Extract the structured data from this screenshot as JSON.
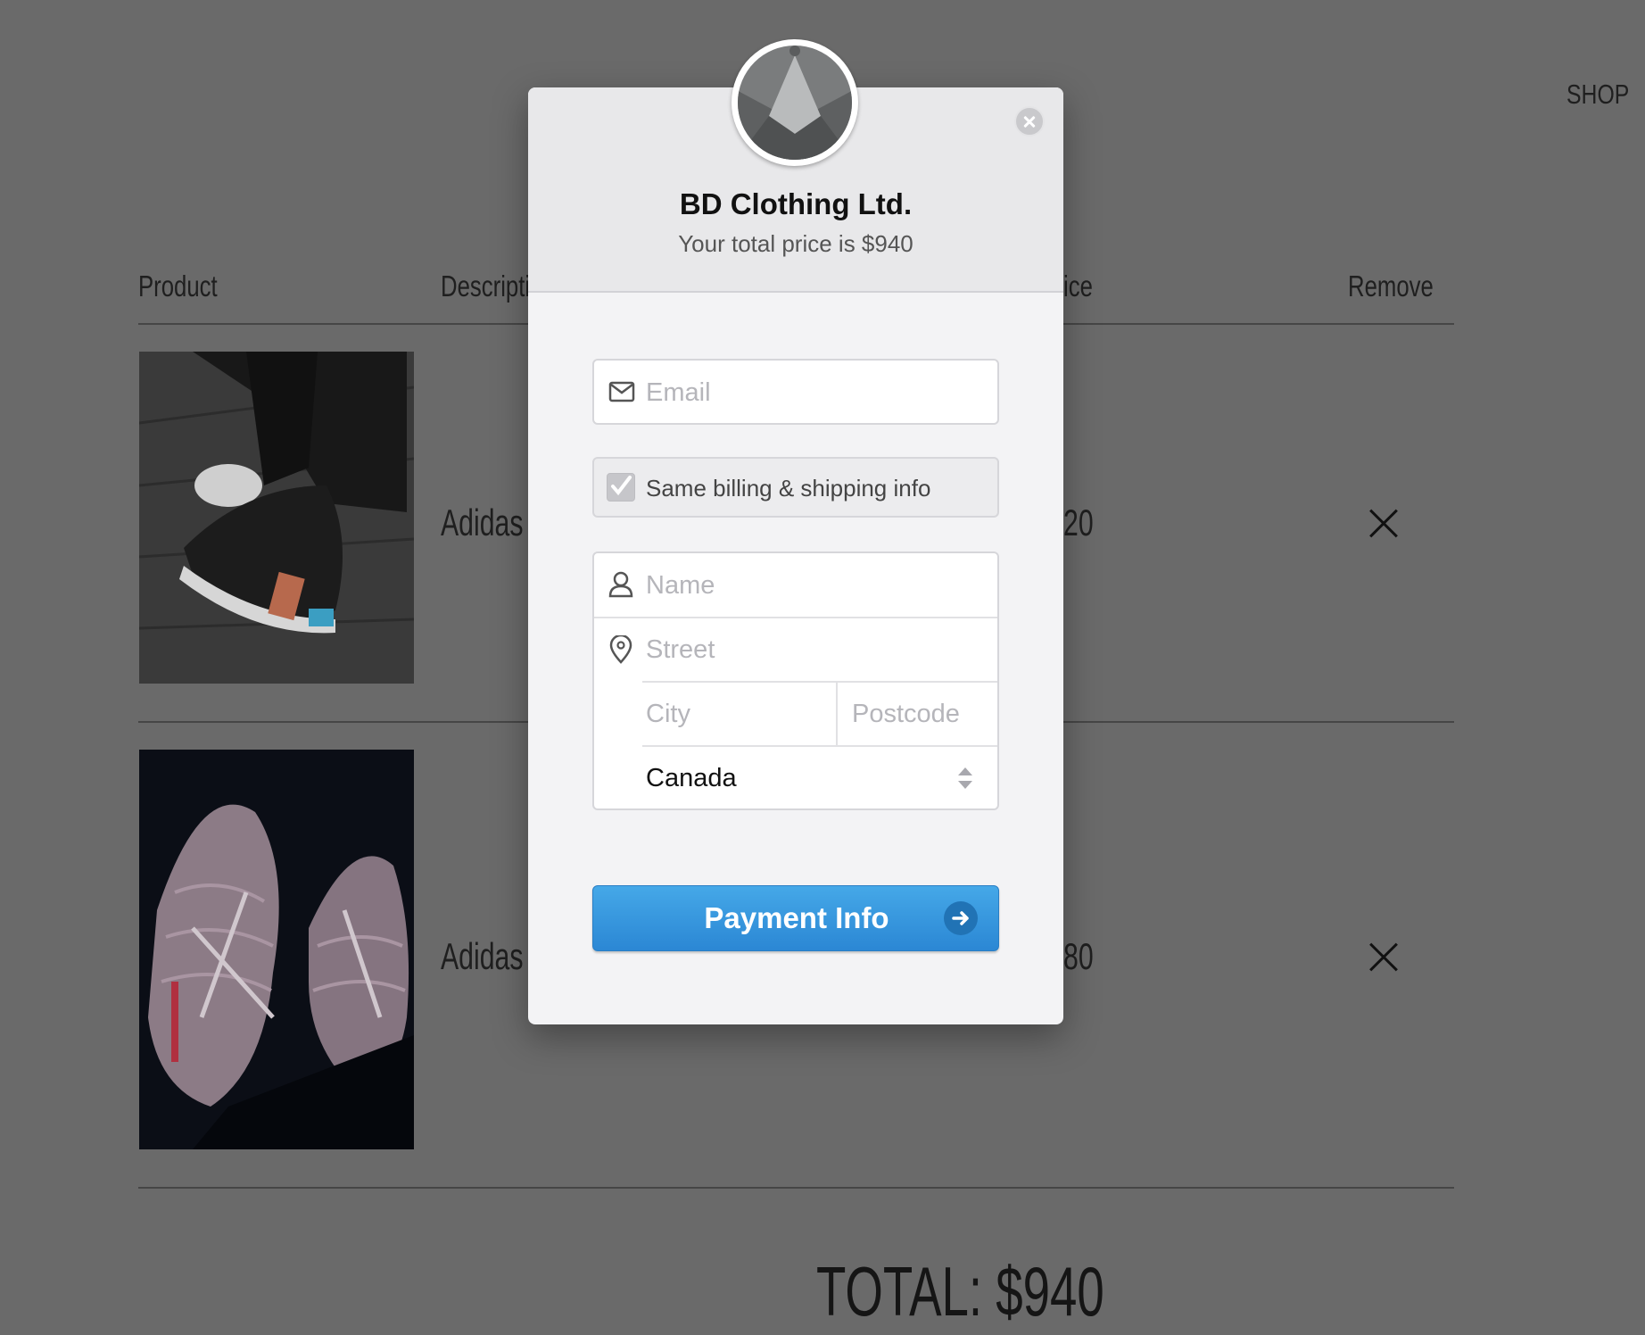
{
  "nav": {
    "shop": "SHOP"
  },
  "table": {
    "headers": {
      "product": "Product",
      "description": "Descriptic",
      "price": "ice",
      "remove": "Remove"
    },
    "rows": [
      {
        "description": "Adidas I",
        "price": "20"
      },
      {
        "description": "Adidas Y",
        "price": "80"
      }
    ]
  },
  "total": "TOTAL: $940",
  "modal": {
    "merchant": "BD Clothing Ltd.",
    "price_line": "Your total price is $940",
    "email_placeholder": "Email",
    "same_billing_label": "Same billing & shipping info",
    "same_billing_checked": true,
    "name_placeholder": "Name",
    "street_placeholder": "Street",
    "city_placeholder": "City",
    "postcode_placeholder": "Postcode",
    "country": "Canada",
    "pay_button": "Payment Info",
    "colors": {
      "button": "#2b87d4",
      "overlay": "#6a6a6a",
      "header": "#e8e8ea"
    }
  }
}
